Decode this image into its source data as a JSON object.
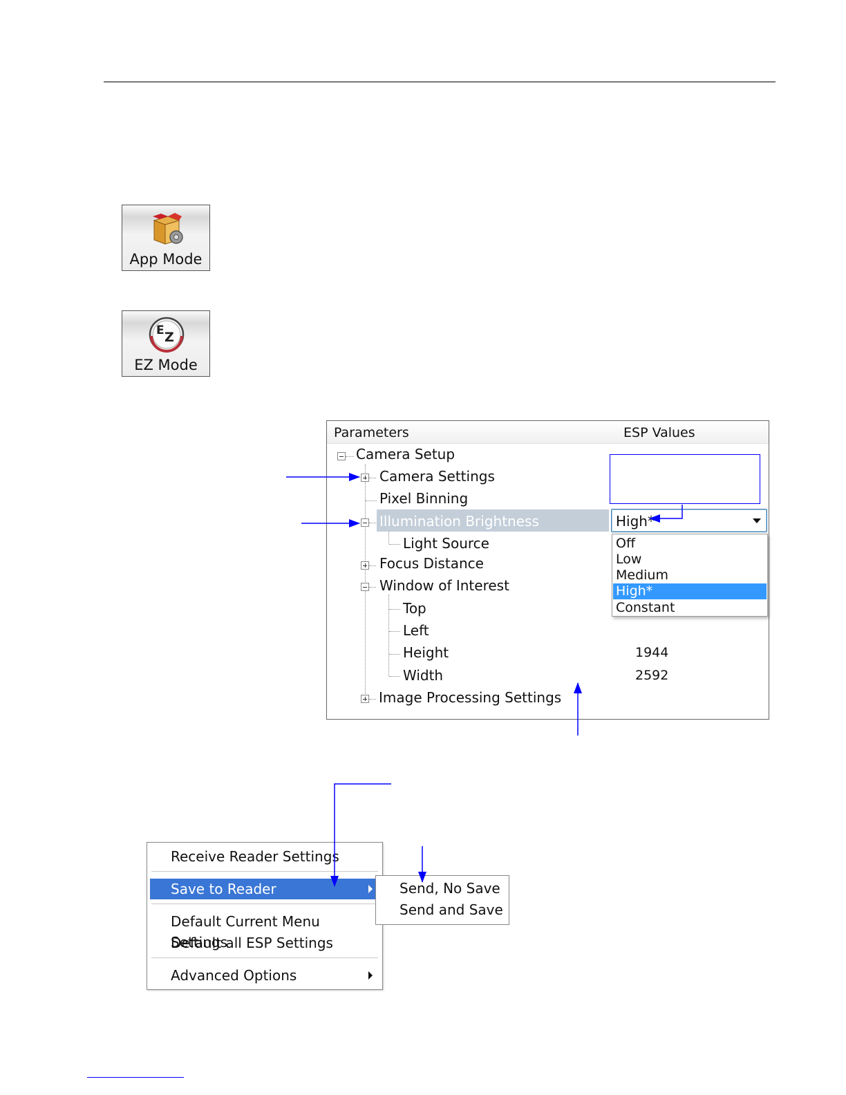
{
  "mode_buttons": {
    "app_mode": {
      "label": "App Mode",
      "icon": "box-gear-icon"
    },
    "ez_mode": {
      "label": "EZ Mode",
      "icon": "ez-icon"
    }
  },
  "tree": {
    "header": {
      "parameters": "Parameters",
      "values": "ESP Values"
    },
    "items": {
      "camera_setup": "Camera Setup",
      "camera_settings": "Camera Settings",
      "pixel_binning": "Pixel Binning",
      "illumination_brightness": "Illumination Brightness",
      "light_source": "Light Source",
      "focus_distance": "Focus Distance",
      "window_of_interest": "Window of Interest",
      "top": "Top",
      "left": "Left",
      "height": "Height",
      "width": "Width",
      "image_processing_settings": "Image Processing Settings"
    },
    "values": {
      "height": "1944",
      "width": "2592"
    },
    "combo": {
      "selected": "High*",
      "options": [
        "Off",
        "Low",
        "Medium",
        "High*",
        "Constant"
      ]
    }
  },
  "context_menu": {
    "items": {
      "receive": "Receive Reader Settings",
      "save": "Save to Reader",
      "default_current": "Default Current Menu Settings",
      "default_all": "Default all ESP Settings",
      "advanced": "Advanced Options"
    },
    "submenu": {
      "send_no_save": "Send, No Save",
      "send_and_save": "Send and Save"
    }
  },
  "colors": {
    "annotation": "#0000ff",
    "selection": "#3399ff",
    "menu_highlight": "#3a76d5",
    "tree_selected_row": "#c3ced9"
  }
}
